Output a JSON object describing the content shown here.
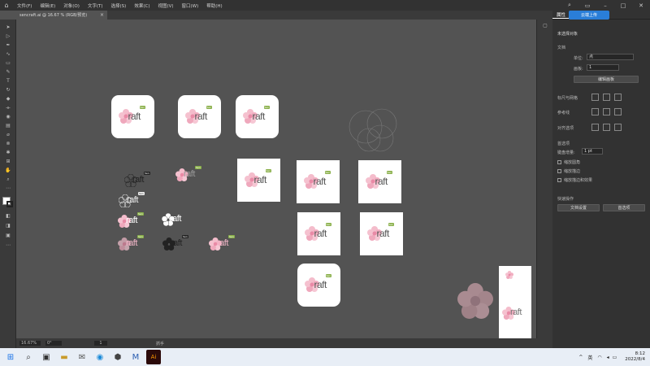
{
  "menubar": {
    "items": [
      "文件(F)",
      "编辑(E)",
      "对象(O)",
      "文字(T)",
      "选择(S)",
      "效果(C)",
      "视图(V)",
      "窗口(W)",
      "帮助(H)"
    ]
  },
  "document_tab": {
    "title": "sencraft.ai @ 16.67 % (RGB/预览)"
  },
  "right_panel": {
    "tabs": [
      "属性",
      "图层",
      "库"
    ],
    "cloud_button": "云端上传",
    "no_selection": "未选择对象",
    "document_label": "文档",
    "unit_label": "单位:",
    "unit_value": "点",
    "artboard_label": "画板:",
    "artboard_value": "1",
    "edit_artboard_button": "编辑画板",
    "rulers_grid_label": "标尺与网格",
    "guides_label": "参考线",
    "snap_label": "对齐选项",
    "preferences_label": "首选项",
    "keyboard_increment_label": "键盘增量:",
    "keyboard_increment_value": "1 pt",
    "check_scale_corners": "缩放圆角",
    "check_scale_strokes": "缩放描边",
    "check_scale_effects": "缩放描边和效果",
    "quick_actions_label": "快速操作",
    "document_setup_button": "文档设置",
    "preferences_button": "首选项"
  },
  "logo": {
    "text": "raft",
    "badge": "Sen"
  },
  "statusbar": {
    "zoom": "16.67%",
    "angle": "0°",
    "artboard_num": "1",
    "tool": "抓手"
  },
  "taskbar": {
    "tray_lang": "英",
    "time": "8:12",
    "date": "2022/8/4"
  },
  "colors": {
    "pink": "#f2b6c8",
    "green": "#8ab04a",
    "accent": "#2a7ed8"
  }
}
